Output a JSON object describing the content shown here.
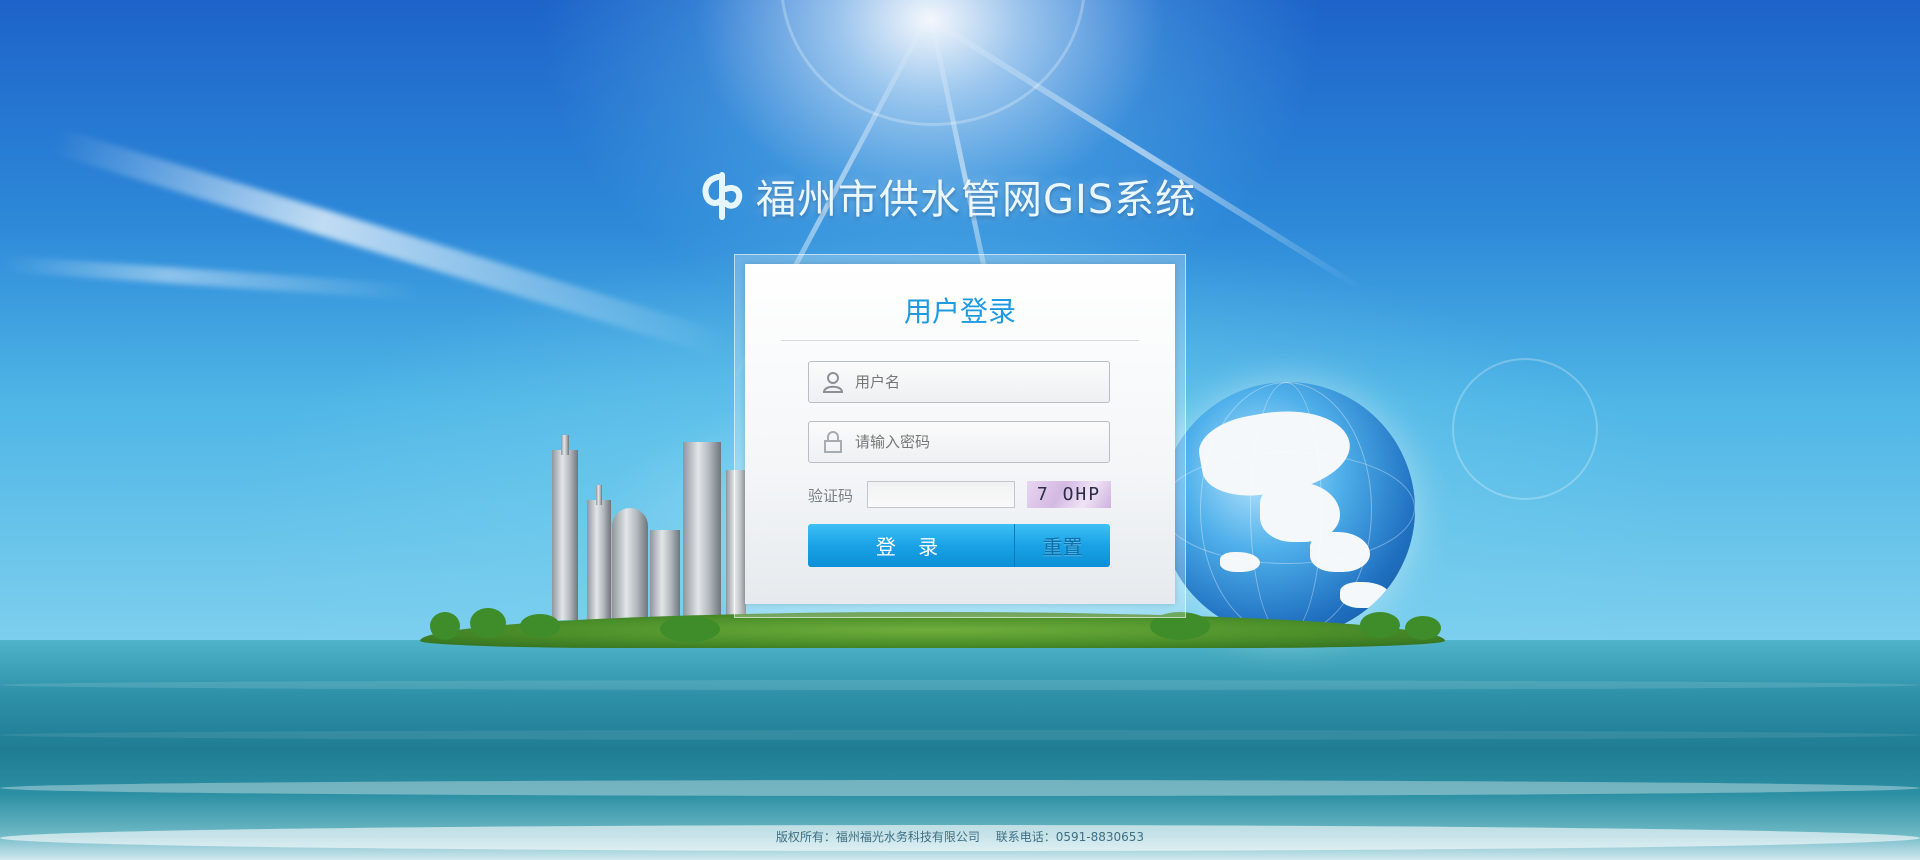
{
  "header": {
    "logo_icon": "water-drop-logo-icon",
    "title": "福州市供水管网GIS系统"
  },
  "login": {
    "title": "用户登录",
    "username_placeholder": "用户名",
    "username_icon": "user-icon",
    "password_placeholder": "请输入密码",
    "password_icon": "lock-icon",
    "captcha_label": "验证码",
    "captcha_value": "",
    "captcha_image_text": "7 OHP",
    "login_button": "登 录",
    "reset_button": "重置"
  },
  "footer": {
    "copyright": "版权所有：福州福光水务科技有限公司",
    "contact": "联系电话：0591-8830653"
  },
  "colors": {
    "accent": "#1e9be0",
    "button": "#1aa2e6"
  }
}
